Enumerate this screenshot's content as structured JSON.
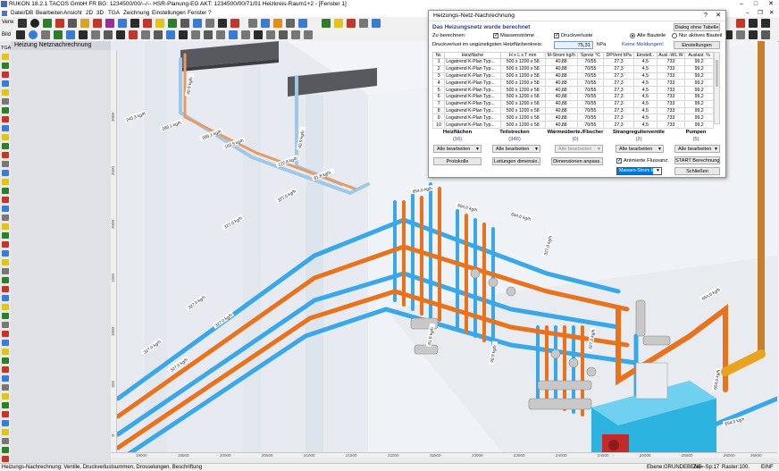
{
  "window": {
    "title": "RUKON 18.2.1  TACOS GmbH FR  BG: 1234500/00/--/-- HSR-Planung-EG  AKT: 1234500/00/71/01 Heizkreis-Raum1+2  - [Fenster 1]"
  },
  "menu": [
    "Datei/DB",
    "Bearbeiten",
    "Ansicht",
    "2D",
    "3D",
    "TGA",
    "Zeichnung",
    "Einstellungen",
    "Fenster",
    "?"
  ],
  "toolbar": {
    "left_labels": [
      "Verw",
      "Bild",
      "TGA"
    ]
  },
  "side_panel": {
    "title": "Heizung Netznachrechnung"
  },
  "dialog": {
    "title": "Heizungs-Netz-Nachrechnung",
    "status": "Das Heizungsnetz wurde berechnet",
    "buttons": {
      "dialog_ohne_tabelle": "Dialog ohne Tabelle",
      "einstellungen": "Einstellungen",
      "protokolle": "Protokolle",
      "leitungen_dimensio": "Leitungen dimensio.",
      "dimensionen_anpass": "Dimensionen anpass.",
      "start_berechnung": "START Berechnung",
      "schliessen": "Schließen"
    },
    "zu_berechnen_label": "Zu berechnen:",
    "checkboxes": {
      "massenstroeme": "Massenströme",
      "druckverluste": "Druckverluste",
      "animierte_flussanz": "Animierte Flussanz."
    },
    "radios": {
      "alle_bauteile": "Alle Bauteile",
      "nur_aktives_bauteil": "Nur aktives Bauteil"
    },
    "druckverlust_label": "Druckverlust im ungünstigsten Heizflächenkreis:",
    "druckverlust_value": "75,31",
    "druckverlust_unit": "hPa",
    "keine_meldungen": "Keine Meldungen!",
    "table": {
      "headers": [
        "Nr.",
        "Heizfläche",
        "H x L x T mm",
        "M-Strom kg/h",
        "Spreiz °C",
        "DPVent hPa",
        "Einstell..",
        "Ausl.-WL W",
        "Auslast. %"
      ],
      "rows": [
        [
          "1",
          "Logatrend K-Plan Typ...",
          "500 x 1200 x 58",
          "40,88",
          "70/55",
          "27,3",
          "4,5",
          "733",
          "99,2"
        ],
        [
          "2",
          "Logatrend K-Plan Typ...",
          "500 x 1200 x 58",
          "40,88",
          "70/55",
          "27,3",
          "4,5",
          "733",
          "99,2"
        ],
        [
          "3",
          "Logatrend K-Plan Typ...",
          "500 x 1200 x 58",
          "40,88",
          "70/55",
          "27,3",
          "4,5",
          "733",
          "99,2"
        ],
        [
          "4",
          "Logatrend K-Plan Typ...",
          "500 x 1200 x 58",
          "40,88",
          "70/55",
          "27,3",
          "4,5",
          "733",
          "99,2"
        ],
        [
          "5",
          "Logatrend K-Plan Typ...",
          "500 x 1200 x 58",
          "40,88",
          "70/55",
          "27,3",
          "4,5",
          "733",
          "99,2"
        ],
        [
          "6",
          "Logatrend K-Plan Typ...",
          "500 x 1200 x 58",
          "40,88",
          "70/55",
          "27,3",
          "4,5",
          "733",
          "99,2"
        ],
        [
          "7",
          "Logatrend K-Plan Typ...",
          "500 x 1200 x 58",
          "40,88",
          "70/55",
          "27,3",
          "4,5",
          "733",
          "99,2"
        ],
        [
          "8",
          "Logatrend K-Plan Typ...",
          "500 x 1200 x 58",
          "40,88",
          "70/55",
          "27,3",
          "4,5",
          "733",
          "99,2"
        ],
        [
          "9",
          "Logatrend K-Plan Typ...",
          "500 x 1200 x 58",
          "40,88",
          "70/55",
          "27,3",
          "4,5",
          "733",
          "99,2"
        ],
        [
          "10",
          "Logatrend K-Plan Typ...",
          "500 x 1200 x 58",
          "40,88",
          "70/55",
          "27,3",
          "4,5",
          "733",
          "99,2"
        ]
      ]
    },
    "sections": [
      {
        "title": "Heizflächen",
        "count": "(16)",
        "dropdown": "Alle bearbeiten",
        "disabled": false
      },
      {
        "title": "Teilstrecken",
        "count": "(346)",
        "dropdown": "Alle bearbeiten",
        "disabled": false
      },
      {
        "title": "Wärmeüberte./Fbscher",
        "count": "(0)",
        "dropdown": "Alle bearbeiten",
        "disabled": true
      },
      {
        "title": "Strangregulierventile",
        "count": "(2)",
        "dropdown": "Alle bearbeiten",
        "disabled": false
      },
      {
        "title": "Pumpen",
        "count": "(5)",
        "dropdown": "Alle bearbeiten",
        "disabled": false
      }
    ],
    "flow_select": "Massen-Strom kg/h"
  },
  "canvas": {
    "flow_labels": [
      "654,0 kg/h",
      "327,0 kg/h",
      "245,3 kg/h",
      "286,1 kg/h",
      "163,5 kg/h",
      "122,6 kg/h",
      "81,8 kg/h",
      "40,9 kg/h",
      "204,4 kg/h",
      "61,3 kg/h"
    ],
    "ruler_x": [
      "19000",
      "19500",
      "20000",
      "20500",
      "21000",
      "21500",
      "22000",
      "22500",
      "23000",
      "23500",
      "24000",
      "24500",
      "25000",
      "25500",
      "26000",
      "26500",
      "27000"
    ],
    "ruler_y": [
      "3000",
      "2500",
      "2000",
      "1500",
      "1000",
      "500",
      "0"
    ],
    "perspective_label": "3D-Perspektive"
  },
  "status": {
    "left": "Heizungs-Nachrechnung: Ventile, Druckverlustsummen, Drosselungen, Beschriftung",
    "ebene": "Ebene:GRUNDEBENE",
    "zw": "Zw=-Sp:17",
    "raster": "Raster:100.",
    "einf": "EINF"
  },
  "colors": {
    "supply": "#e8731c",
    "return": "#3aa8e8",
    "dialog_heading": "#2a3d8c",
    "boiler": "#2db3e0"
  }
}
